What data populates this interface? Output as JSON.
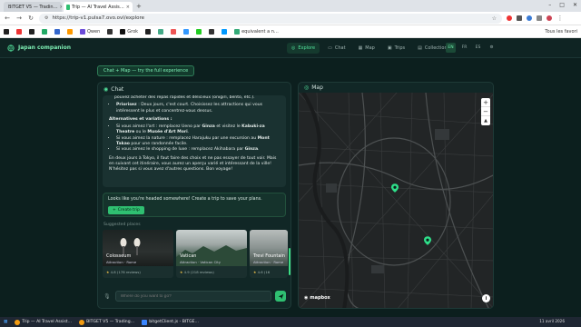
{
  "browser": {
    "tabs": [
      {
        "label": "BITGET V5 — Tradin…",
        "color": "#f0b90b"
      },
      {
        "label": "Trip — AI Travel Assis…",
        "color": "#2fbf71"
      }
    ],
    "new_tab": "+",
    "url": "https://trip-v1.pulsa7.ovo.ovl/explore",
    "bookmarks": [
      {
        "label": "",
        "color": "#222"
      },
      {
        "label": "",
        "color": "#e33"
      },
      {
        "label": "",
        "color": "#222"
      },
      {
        "label": "",
        "color": "#2a6"
      },
      {
        "label": "",
        "color": "#36c"
      },
      {
        "label": "",
        "color": "#f90"
      },
      {
        "label": "Qwen",
        "color": "#6b4bd8"
      },
      {
        "label": "",
        "color": "#333"
      },
      {
        "label": "Grok",
        "color": "#111"
      },
      {
        "label": "",
        "color": "#222"
      },
      {
        "label": "",
        "color": "#4a8"
      },
      {
        "label": "",
        "color": "#e55"
      },
      {
        "label": "",
        "color": "#39f"
      },
      {
        "label": "",
        "color": "#2c2"
      },
      {
        "label": "",
        "color": "#333"
      },
      {
        "label": "",
        "color": "#09f"
      },
      {
        "label": "equivalent a n…",
        "color": "#3a7"
      }
    ],
    "all_bookmarks": "Tous les favori"
  },
  "app": {
    "brand": "Japan companion",
    "nav": [
      {
        "label": "Explore",
        "active": true
      },
      {
        "label": "Chat",
        "active": false
      },
      {
        "label": "Map",
        "active": false
      },
      {
        "label": "Trips",
        "active": false
      },
      {
        "label": "Collections",
        "active": false
      }
    ],
    "langs": [
      {
        "label": "EN",
        "active": true
      },
      {
        "label": "FR",
        "active": false
      },
      {
        "label": "ES",
        "active": false
      }
    ],
    "promo": "Chat + Map — try the full experience"
  },
  "chat": {
    "title": "Chat",
    "message": {
      "line1": "pouvez acheter des repas rapides et délicieux (onigiri, bento, etc.).",
      "bullet_prioritize_bold": "Priorisez",
      "bullet_prioritize": " : Deux jours, c'est court. Choisissez les attractions qui vous intéressent le plus et concentrez-vous dessus.",
      "alt_title": "Alternatives et variations :",
      "alt1_pre": "Si vous aimez l'art : remplacez Ueno par ",
      "alt1_b1": "Ginza",
      "alt1_mid": " et visitez le ",
      "alt1_b2": "Kabuki-za Theatre",
      "alt1_mid2": " ou le ",
      "alt1_b3": "Musée d'Art Mori",
      "alt1_end": ".",
      "alt2_pre": "Si vous aimez la nature : remplacez Harajuku par une excursion au ",
      "alt2_b": "Mont Takao",
      "alt2_end": " pour une randonnée facile.",
      "alt3_pre": "Si vous aimez le shopping de luxe : remplacez Akihabara par ",
      "alt3_b": "Ginza",
      "alt3_end": ".",
      "closing": "En deux jours à Tokyo, il faut faire des choix et ne pas essayer de tout voir. Mais en suivant cet itinéraire, vous aurez un aperçu varié et intéressant de la ville! N'hésitez pas si vous avez d'autres questions. Bon voyage!"
    },
    "cta_text": "Looks like you're headed somewhere! Create a trip to save your plans.",
    "cta_button": "Create trip",
    "suggested_title": "Suggested places",
    "cards": [
      {
        "name": "Colosseum",
        "sub": "Attraction · Rome",
        "rating": "4.8",
        "reviews": "(178 reviews)"
      },
      {
        "name": "Vatican",
        "sub": "Attraction · Vatican City",
        "rating": "4.9",
        "reviews": "(218 reviews)"
      },
      {
        "name": "Trevi Fountain",
        "sub": "Attraction · Rome",
        "rating": "4.6",
        "reviews": "(16"
      }
    ],
    "input_placeholder": "Where do you want to go?"
  },
  "map": {
    "title": "Map",
    "zoom_in": "+",
    "zoom_out": "−",
    "compass": "▲",
    "attribution": "mapbox",
    "info": "i",
    "marker_color": "#2fe08a"
  },
  "taskbar": {
    "items": [
      {
        "label": "Trip — AI Travel Assist…"
      },
      {
        "label": "BITGET V5 — Trading…"
      },
      {
        "label": "bitgetClient.js - BITGE…"
      }
    ],
    "clock": "11 avril 2026"
  }
}
